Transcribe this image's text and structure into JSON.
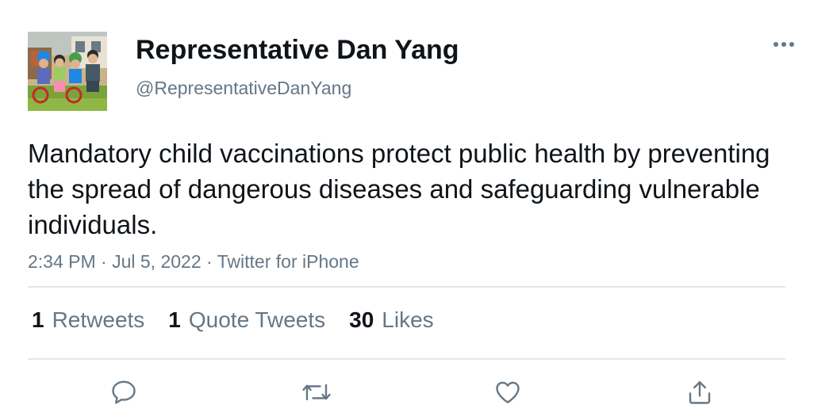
{
  "tweet": {
    "display_name": "Representative Dan Yang",
    "handle": "@RepresentativeDanYang",
    "avatar_icon": "family-photo-avatar",
    "text": "Mandatory child vaccinations protect public health by preventing the spread of dangerous diseases and safeguarding vulnerable individuals.",
    "meta": "2:34 PM · Jul 5, 2022 · Twitter for iPhone"
  },
  "stats": [
    {
      "count": "1",
      "label": "Retweets"
    },
    {
      "count": "1",
      "label": "Quote Tweets"
    },
    {
      "count": "30",
      "label": "Likes"
    }
  ],
  "actions": [
    {
      "icon": "reply-icon"
    },
    {
      "icon": "retweet-icon"
    },
    {
      "icon": "like-icon"
    },
    {
      "icon": "share-icon"
    }
  ],
  "more_icon": "more-options-icon",
  "colors": {
    "text_primary": "#0f1419",
    "text_secondary": "#657786",
    "divider": "#e1e8ed",
    "icon": "#657786"
  }
}
